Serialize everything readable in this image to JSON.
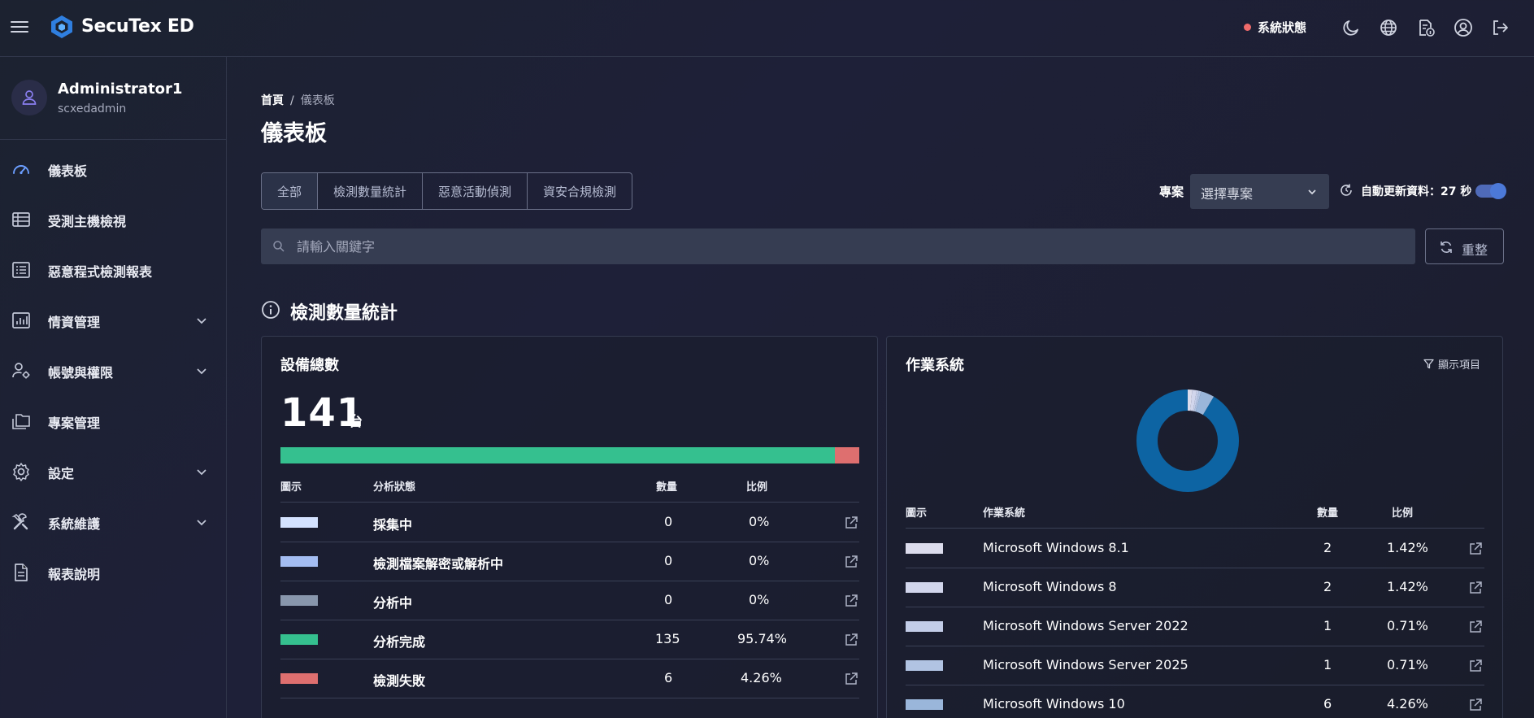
{
  "header": {
    "brand": "SecuTex ED",
    "system_status_label": "系統狀態",
    "status_color": "#ef6b6b",
    "icons": [
      "menu-icon",
      "moon-icon",
      "globe-icon",
      "document-info-icon",
      "user-circle-icon",
      "logout-icon"
    ]
  },
  "user": {
    "name": "Administrator1",
    "login": "scxedadmin"
  },
  "sidebar": {
    "items": [
      {
        "label": "儀表板",
        "icon": "dashboard-gauge-icon",
        "expandable": false
      },
      {
        "label": "受測主機檢視",
        "icon": "table-list-icon",
        "expandable": false
      },
      {
        "label": "惡意程式檢測報表",
        "icon": "report-list-icon",
        "expandable": false
      },
      {
        "label": "情資管理",
        "icon": "bar-chart-icon",
        "expandable": true
      },
      {
        "label": "帳號與權限",
        "icon": "user-gear-icon",
        "expandable": true
      },
      {
        "label": "專案管理",
        "icon": "folders-icon",
        "expandable": false
      },
      {
        "label": "設定",
        "icon": "gear-icon",
        "expandable": true
      },
      {
        "label": "系統維護",
        "icon": "tools-icon",
        "expandable": true
      },
      {
        "label": "報表說明",
        "icon": "document-icon",
        "expandable": false
      }
    ]
  },
  "breadcrumb": {
    "home": "首頁",
    "separator": "/",
    "current": "儀表板"
  },
  "page_title": "儀表板",
  "tabs": [
    "全部",
    "檢測數量統計",
    "惡意活動偵測",
    "資安合規檢測"
  ],
  "project": {
    "label": "專案",
    "selected": "選擇專案"
  },
  "auto_refresh": {
    "label": "自動更新資料：27 秒",
    "enabled": true
  },
  "search": {
    "placeholder": "請輸入關鍵字"
  },
  "reset_label": "重整",
  "section_title": "檢測數量統計",
  "devices": {
    "title": "設備總數",
    "total": "141",
    "unit": "台",
    "columns": [
      "圖示",
      "分析狀態",
      "數量",
      "比例"
    ],
    "rows": [
      {
        "status": "採集中",
        "count": "0",
        "ratio": "0%",
        "color": "#d4e2ff"
      },
      {
        "status": "檢測檔案解密或解析中",
        "count": "0",
        "ratio": "0%",
        "color": "#a4bdf2"
      },
      {
        "status": "分析中",
        "count": "0",
        "ratio": "0%",
        "color": "#8896ac"
      },
      {
        "status": "分析完成",
        "count": "135",
        "ratio": "95.74%",
        "color": "#35c08f"
      },
      {
        "status": "檢測失敗",
        "count": "6",
        "ratio": "4.26%",
        "color": "#de6f6f"
      }
    ],
    "bar_fractions": [
      0,
      0,
      0,
      0.9574,
      0.0426
    ]
  },
  "os": {
    "title": "作業系統",
    "filter_label": "顯示項目",
    "columns": [
      "圖示",
      "作業系統",
      "數量",
      "比例"
    ],
    "rows": [
      {
        "name": "Microsoft Windows 8.1",
        "count": "2",
        "ratio": "1.42%",
        "color": "#dcdcec"
      },
      {
        "name": "Microsoft Windows 8",
        "count": "2",
        "ratio": "1.42%",
        "color": "#d2d6ec"
      },
      {
        "name": "Microsoft Windows Server 2022",
        "count": "1",
        "ratio": "0.71%",
        "color": "#c3cde8"
      },
      {
        "name": "Microsoft Windows Server 2025",
        "count": "1",
        "ratio": "0.71%",
        "color": "#b1c3e2"
      },
      {
        "name": "Microsoft Windows 10",
        "count": "6",
        "ratio": "4.26%",
        "color": "#9ab6da"
      }
    ],
    "donut_slices": [
      {
        "value": 2,
        "color": "#dcdcec"
      },
      {
        "value": 2,
        "color": "#d2d6ec"
      },
      {
        "value": 1,
        "color": "#c3cde8"
      },
      {
        "value": 1,
        "color": "#b1c3e2"
      },
      {
        "value": 6,
        "color": "#9ab6da"
      },
      {
        "value": 129,
        "color": "#0d64a3"
      }
    ]
  }
}
